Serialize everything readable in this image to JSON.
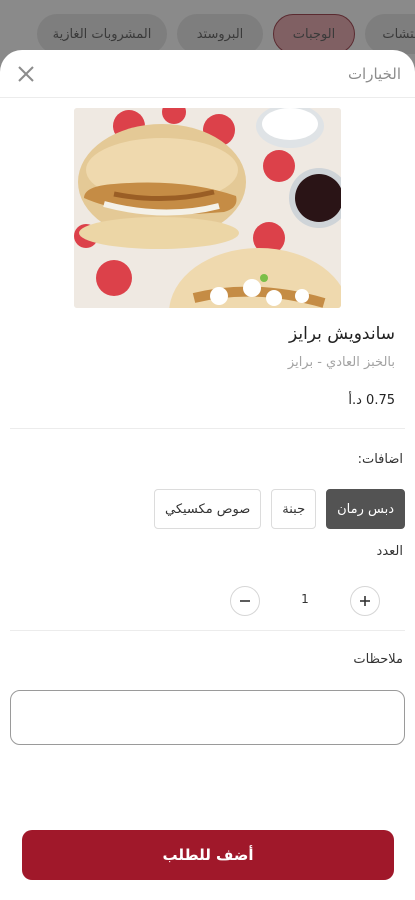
{
  "categories": [
    {
      "label": "بتشات"
    },
    {
      "label": "الوجبات"
    },
    {
      "label": "البروستد"
    },
    {
      "label": "المشروبات الغازية"
    }
  ],
  "sheet": {
    "title": "الخيارات",
    "close_icon": "close-icon"
  },
  "product": {
    "name": "ساندويش برايز",
    "description": "بالخبز العادي - برايز",
    "price": "0.75 د.أ",
    "image": "sandwich-photo"
  },
  "addons": {
    "label": "اضافات:",
    "options": [
      {
        "label": "دبس رمان",
        "selected": true
      },
      {
        "label": "جبنة",
        "selected": false
      },
      {
        "label": "صوص مكسيكي",
        "selected": false
      }
    ]
  },
  "quantity": {
    "label": "العدد",
    "value": "1"
  },
  "notes": {
    "label": "ملاحظات",
    "value": "",
    "placeholder": ""
  },
  "cta": {
    "label": "أضف للطلب"
  },
  "colors": {
    "brand": "#a0182a",
    "selected_chip": "#535353"
  }
}
